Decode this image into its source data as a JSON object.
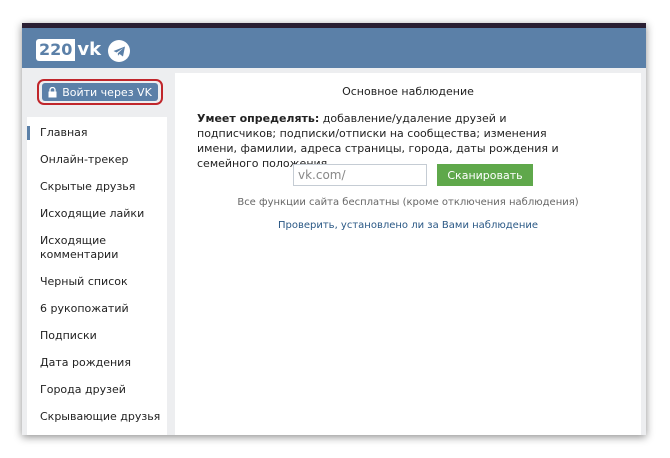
{
  "header": {
    "logo_number": "220",
    "logo_suffix": "vk",
    "telegram_icon": "telegram-icon"
  },
  "sidebar": {
    "login_button": "Войти через VK",
    "login_icon": "lock-icon",
    "items": [
      {
        "label": "Главная",
        "active": true
      },
      {
        "label": "Онлайн-трекер"
      },
      {
        "label": "Скрытые друзья"
      },
      {
        "label": "Исходящие лайки"
      },
      {
        "label": "Исходящие комментарии"
      },
      {
        "label": "Черный список"
      },
      {
        "label": "6 рукопожатий"
      },
      {
        "label": "Подписки"
      },
      {
        "label": "Дата рождения"
      },
      {
        "label": "Города друзей"
      },
      {
        "label": "Скрывающие друзья"
      }
    ]
  },
  "main": {
    "title": "Основное наблюдение",
    "desc_bold": "Умеет определять:",
    "desc_text": " добавление/удаление друзей и подписчиков; подписки/отписки на сообщества; изменения имени, фамилии, адреса страницы, города, даты рождения и семейного положения.",
    "input_placeholder": "vk.com/",
    "scan_button": "Сканировать",
    "free_note": "Все функции сайта бесплатны (кроме отключения наблюдения)",
    "check_link": "Проверить, установлено ли за Вами наблюдение"
  },
  "colors": {
    "header_bg": "#5b80a8",
    "scan_button_bg": "#5fa84b",
    "highlight_border": "#c0262b"
  }
}
